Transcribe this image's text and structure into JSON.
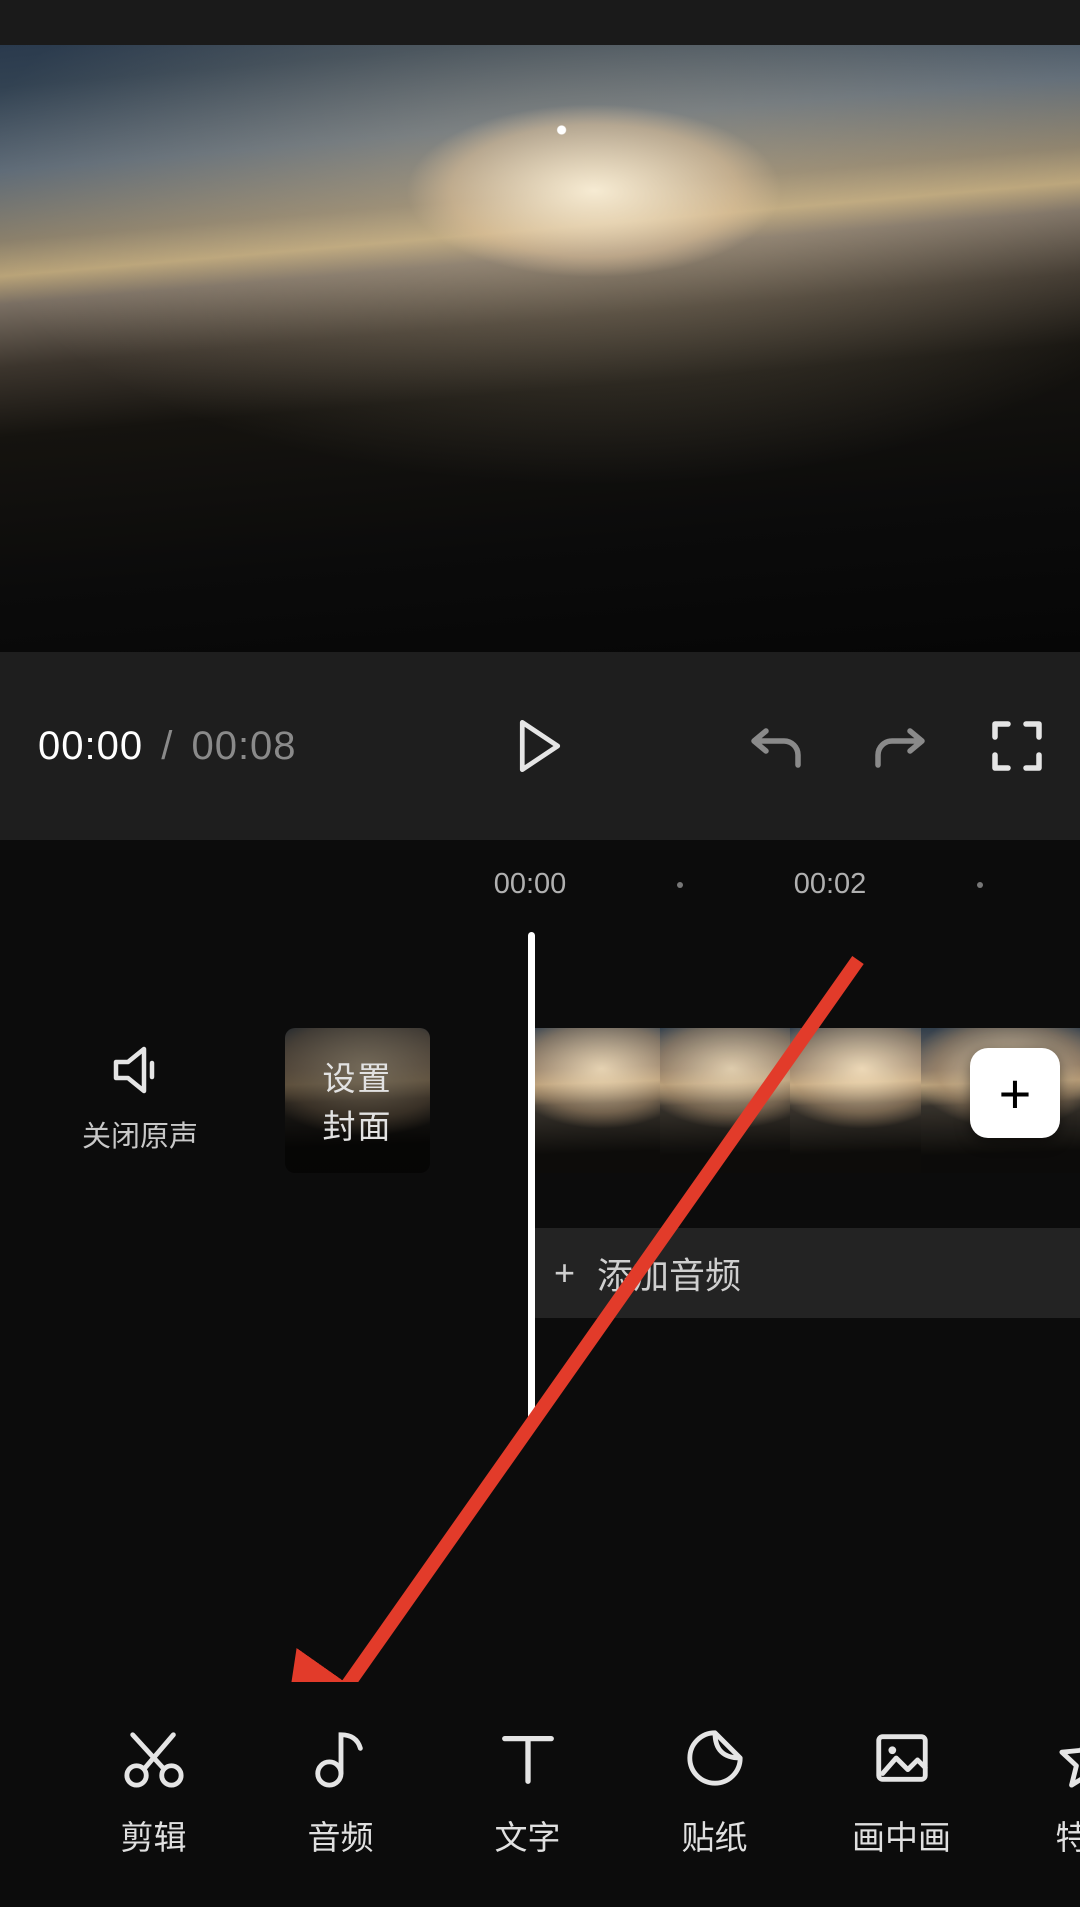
{
  "transport": {
    "current_time": "00:00",
    "separator": " / ",
    "total_time": "00:08"
  },
  "ruler": {
    "marks": [
      "00:00",
      "00:02"
    ]
  },
  "mute": {
    "label": "关闭原声"
  },
  "cover": {
    "line1": "设置",
    "line2": "封面"
  },
  "add_clip": {
    "symbol": "+"
  },
  "audio": {
    "add_audio_symbol": "+",
    "add_audio_label": "添加音频"
  },
  "toolbar": {
    "items": [
      {
        "id": "cut",
        "label": "剪辑"
      },
      {
        "id": "audio",
        "label": "音频"
      },
      {
        "id": "text",
        "label": "文字"
      },
      {
        "id": "sticker",
        "label": "贴纸"
      },
      {
        "id": "pip",
        "label": "画中画"
      },
      {
        "id": "effect",
        "label": "特效"
      }
    ]
  }
}
